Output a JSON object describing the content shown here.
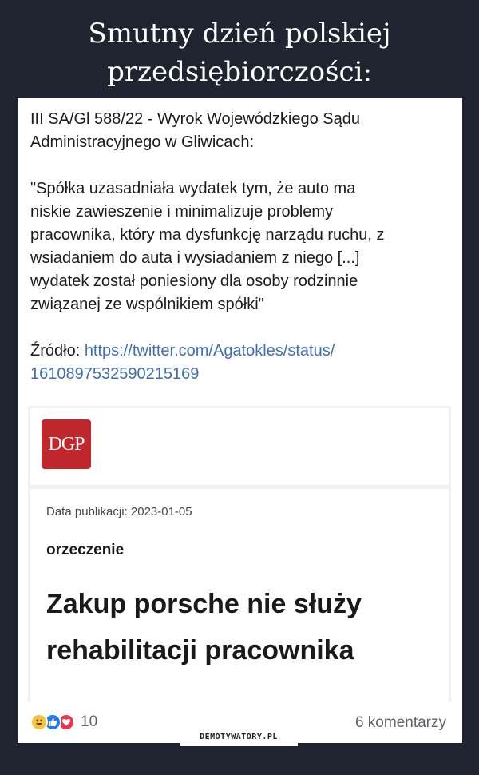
{
  "meme": {
    "title_line1": "Smutny dzień polskiej",
    "title_line2": "przedsiębiorczości:"
  },
  "post": {
    "line1": "III SA/Gl 588/22 - Wyrok Wojewódzkiego Sądu",
    "line2": "Administracyjnego w Gliwicach:",
    "quote": [
      "\"Spółka uzasadniała wydatek tym, że auto ma",
      "niskie zawieszenie i minimalizuje problemy",
      "pracownika, który ma dysfunkcję narządu ruchu, z",
      "wsiadaniem do auta i wysiadaniem z niego [...]",
      "wydatek został poniesiony dla osoby rodzinnie",
      "związanej ze wspólnikiem spółki\""
    ],
    "source_label": "Źródło: ",
    "source_url_line1": "https://twitter.com/Agatokles/status/",
    "source_url_line2": "1610897532590215169"
  },
  "article": {
    "logo_text": "DGP",
    "pub_date": "Data publikacji: 2023-01-05",
    "category": "orzeczenie",
    "headline_line1": "Zakup porsche nie służy",
    "headline_line2": "rehabilitacji pracownika"
  },
  "footer": {
    "reactions": [
      "haha-icon",
      "like-icon",
      "love-icon"
    ],
    "reaction_count": "10",
    "comments": "6 komentarzy"
  },
  "watermark": "DEMOTYWATORY.PL",
  "colors": {
    "background": "#202430",
    "link": "#3f6fb5",
    "logo_red": "#c0272d",
    "like_blue": "#1d78f2",
    "love_red": "#f0364f",
    "haha_yellow": "#f7c23c"
  }
}
